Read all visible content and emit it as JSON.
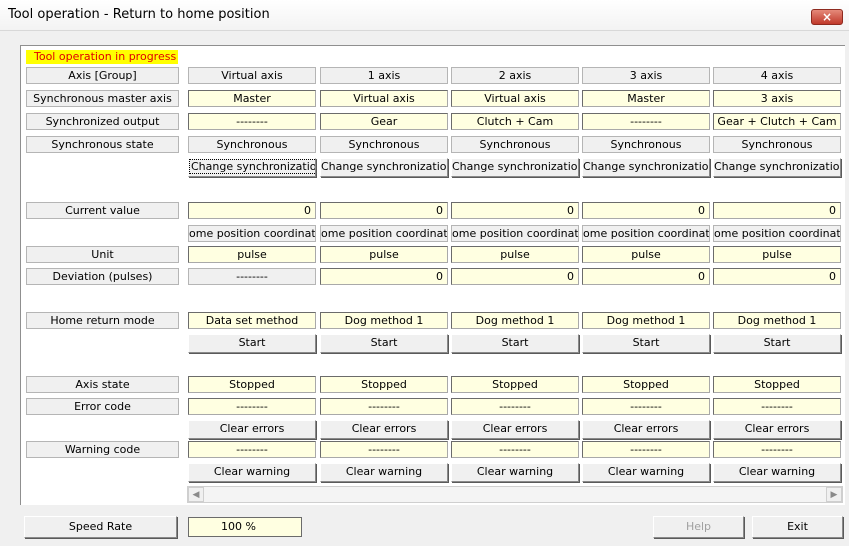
{
  "window": {
    "title": "Tool operation - Return to home position",
    "close_glyph": "×"
  },
  "status_badge": "Tool operation in progress",
  "axes": [
    "Virtual axis",
    "1 axis",
    "2 axis",
    "3 axis",
    "4 axis"
  ],
  "labels": {
    "axis_group": "Axis [Group]",
    "sync_master": "Synchronous master axis",
    "sync_output": "Synchronized output",
    "sync_state": "Synchronous state",
    "current_value": "Current value",
    "unit": "Unit",
    "deviation": "Deviation (pulses)",
    "home_return_mode": "Home return mode",
    "axis_state": "Axis state",
    "error_code": "Error code",
    "warning_code": "Warning code"
  },
  "sync_master": [
    "Master",
    "Virtual axis",
    "Virtual axis",
    "Master",
    "3 axis"
  ],
  "sync_output": [
    "--------",
    "Gear",
    "Clutch + Cam",
    "--------",
    "Gear + Clutch + Cam"
  ],
  "sync_state": [
    "Synchronous",
    "Synchronous",
    "Synchronous",
    "Synchronous",
    "Synchronous"
  ],
  "change_sync_label": "Change synchronization",
  "current_value": [
    "0",
    "0",
    "0",
    "0",
    "0"
  ],
  "coord_label": "ome position coordinate",
  "unit": [
    "pulse",
    "pulse",
    "pulse",
    "pulse",
    "pulse"
  ],
  "deviation": [
    "--------",
    "0",
    "0",
    "0",
    "0"
  ],
  "home_return_mode": [
    "Data set method",
    "Dog method 1",
    "Dog method 1",
    "Dog method 1",
    "Dog method 1"
  ],
  "start_label": "Start",
  "axis_state": [
    "Stopped",
    "Stopped",
    "Stopped",
    "Stopped",
    "Stopped"
  ],
  "error_code": [
    "--------",
    "--------",
    "--------",
    "--------",
    "--------"
  ],
  "clear_errors_label": "Clear errors",
  "warning_code": [
    "--------",
    "--------",
    "--------",
    "--------",
    "--------"
  ],
  "clear_warning_label": "Clear warning",
  "scroll": {
    "left_arrow": "◀",
    "right_arrow": "▶"
  },
  "footer": {
    "speed_rate_label": "Speed Rate",
    "speed_rate_value": "100 %",
    "help_label": "Help",
    "exit_label": "Exit"
  }
}
